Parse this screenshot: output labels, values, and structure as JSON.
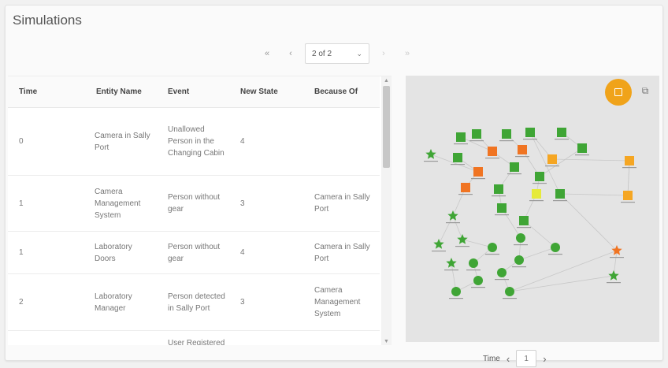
{
  "page": {
    "title": "Simulations"
  },
  "pager": {
    "first": "«",
    "prev": "‹",
    "current": "2 of 2",
    "next": "›",
    "last": "»"
  },
  "table": {
    "headers": [
      "Time",
      "Entity Name",
      "Event",
      "New State",
      "Because Of"
    ],
    "rows": [
      {
        "time": "0",
        "entity": "Camera in Sally Port",
        "event": "Unallowed Person in the Changing Cabin",
        "state": "4",
        "because": ""
      },
      {
        "time": "1",
        "entity": "Camera Management System",
        "event": "Person without gear",
        "state": "3",
        "because": "Camera in Sally Port"
      },
      {
        "time": "1",
        "entity": "Laboratory Doors",
        "event": "Person without gear",
        "state": "4",
        "because": "Camera in Sally Port"
      },
      {
        "time": "2",
        "entity": "Laboratory Manager",
        "event": "Person detected in Sally Port",
        "state": "3",
        "because": "Camera Management System"
      },
      {
        "time": "",
        "entity": "",
        "event": "User Registered",
        "state": "",
        "because": ""
      }
    ]
  },
  "graph": {
    "colors": {
      "green": "#3fa535",
      "orange": "#f07422",
      "amber": "#f5a623",
      "yellow": "#e6ea3a",
      "edge": "#c8c8c8"
    }
  },
  "time_control": {
    "label": "Time",
    "value": "1"
  }
}
